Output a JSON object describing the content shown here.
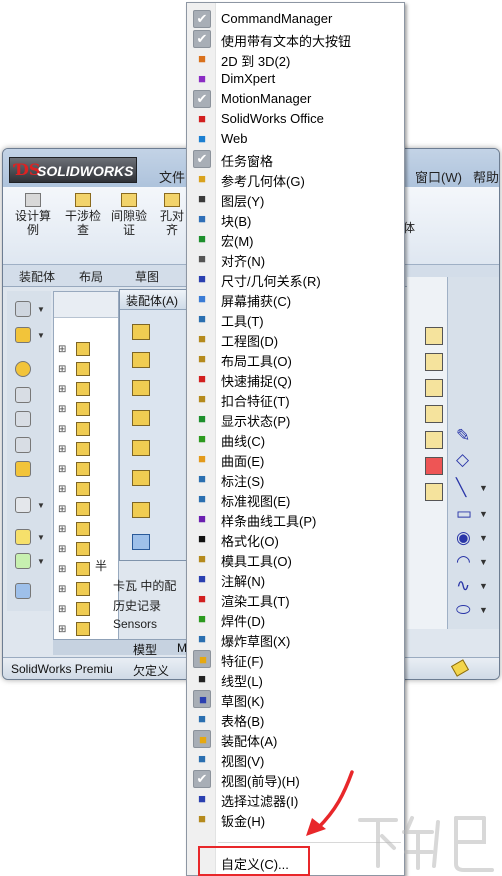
{
  "window": {
    "logo_mark": "ƊS",
    "logo_text": "SOLIDWORKS",
    "menu_file": "文件",
    "menu_window": "窗口(W)",
    "menu_help": "帮助",
    "ribbon_buttons": [
      "设计算例",
      "干涉检查",
      "间隙验证",
      "孔对齐"
    ],
    "ribbon_right_fragment": "体",
    "tabs": [
      "装配体",
      "布局",
      "草图"
    ],
    "assembly_panel_title": "装配体(A)",
    "tree_items": [
      "半",
      "卡瓦 中的配",
      "历史记录",
      "Sensors"
    ],
    "bottom_tabs": [
      "模型",
      "M"
    ],
    "status_left": "SolidWorks Premiu",
    "status_right": "欠定义"
  },
  "context_menu": {
    "items": [
      {
        "label": "CommandManager",
        "checked": true,
        "icon": "check-icon"
      },
      {
        "label": "使用带有文本的大按钮",
        "checked": true,
        "icon": "check-icon"
      },
      {
        "label": "2D 到 3D(2)",
        "checked": false,
        "icon": "2d-to-3d-icon",
        "color": "#d9711d"
      },
      {
        "label": "DimXpert",
        "checked": false,
        "icon": "dimxpert-icon",
        "color": "#8b2cc4"
      },
      {
        "label": "MotionManager",
        "checked": true,
        "icon": "check-icon"
      },
      {
        "label": "SolidWorks Office",
        "checked": false,
        "icon": "solidworks-office-icon",
        "color": "#d21f1f"
      },
      {
        "label": "Web",
        "checked": false,
        "icon": "web-globe-icon",
        "color": "#1b7fd1"
      },
      {
        "label": "任务窗格",
        "checked": true,
        "icon": "check-icon"
      },
      {
        "label": "参考几何体(G)",
        "checked": false,
        "icon": "reference-geometry-icon",
        "color": "#d9a21d"
      },
      {
        "label": "图层(Y)",
        "checked": false,
        "icon": "layer-icon",
        "color": "#3a3a3a"
      },
      {
        "label": "块(B)",
        "checked": false,
        "icon": "block-icon",
        "color": "#2f6fb7"
      },
      {
        "label": "宏(M)",
        "checked": false,
        "icon": "macro-icon",
        "color": "#1d8f2c"
      },
      {
        "label": "对齐(N)",
        "checked": false,
        "icon": "align-icon",
        "color": "#555555"
      },
      {
        "label": "尺寸/几何关系(R)",
        "checked": false,
        "icon": "dimension-icon",
        "color": "#2a3fb0"
      },
      {
        "label": "屏幕捕获(C)",
        "checked": false,
        "icon": "screen-capture-icon",
        "color": "#3a7bd5"
      },
      {
        "label": "工具(T)",
        "checked": false,
        "icon": "tools-icon",
        "color": "#2a6fb0"
      },
      {
        "label": "工程图(D)",
        "checked": false,
        "icon": "drawing-icon",
        "color": "#b58a1d"
      },
      {
        "label": "布局工具(O)",
        "checked": false,
        "icon": "layout-tools-icon",
        "color": "#b58a1d"
      },
      {
        "label": "快速捕捉(Q)",
        "checked": false,
        "icon": "quick-snap-icon",
        "color": "#d21f1f"
      },
      {
        "label": "扣合特征(T)",
        "checked": false,
        "icon": "fastening-feature-icon",
        "color": "#b58a1d"
      },
      {
        "label": "显示状态(P)",
        "checked": false,
        "icon": "display-state-icon",
        "color": "#1d8f2c"
      },
      {
        "label": "曲线(C)",
        "checked": false,
        "icon": "curve-icon",
        "color": "#2c9a1f"
      },
      {
        "label": "曲面(E)",
        "checked": false,
        "icon": "surface-icon",
        "color": "#e39a1b"
      },
      {
        "label": "标注(S)",
        "checked": false,
        "icon": "annotation-icon",
        "color": "#2a6fb0"
      },
      {
        "label": "标准视图(E)",
        "checked": false,
        "icon": "standard-views-icon",
        "color": "#2a6fb0"
      },
      {
        "label": "样条曲线工具(P)",
        "checked": false,
        "icon": "spline-tools-icon",
        "color": "#6b1fb0"
      },
      {
        "label": "格式化(O)",
        "checked": false,
        "icon": "format-icon",
        "color": "#111111"
      },
      {
        "label": "模具工具(O)",
        "checked": false,
        "icon": "mold-tools-icon",
        "color": "#b58a1d"
      },
      {
        "label": "注解(N)",
        "checked": false,
        "icon": "note-icon",
        "color": "#2a3fb0"
      },
      {
        "label": "渲染工具(T)",
        "checked": false,
        "icon": "render-tools-icon",
        "color": "#d21f1f"
      },
      {
        "label": "焊件(D)",
        "checked": false,
        "icon": "weldment-icon",
        "color": "#2c9a1f"
      },
      {
        "label": "爆炸草图(X)",
        "checked": false,
        "icon": "explode-sketch-icon",
        "color": "#2a6fb0"
      },
      {
        "label": "特征(F)",
        "checked": true,
        "icon": "features-icon",
        "color": "#e6a80f"
      },
      {
        "label": "线型(L)",
        "checked": false,
        "icon": "line-format-icon",
        "color": "#222222"
      },
      {
        "label": "草图(K)",
        "checked": true,
        "icon": "sketch-icon",
        "color": "#2a3fb0"
      },
      {
        "label": "表格(B)",
        "checked": false,
        "icon": "table-icon",
        "color": "#2a6fb0"
      },
      {
        "label": "装配体(A)",
        "checked": true,
        "icon": "assembly-icon",
        "color": "#e6a80f"
      },
      {
        "label": "视图(V)",
        "checked": false,
        "icon": "view-icon",
        "color": "#2a6fb0"
      },
      {
        "label": "视图(前导)(H)",
        "checked": true,
        "icon": "check-icon"
      },
      {
        "label": "选择过滤器(I)",
        "checked": false,
        "icon": "selection-filter-icon",
        "color": "#2a3fb0"
      },
      {
        "label": "钣金(H)",
        "checked": false,
        "icon": "sheet-metal-icon",
        "color": "#b58a1d"
      }
    ],
    "customize_label": "自定义(C)..."
  },
  "colors": {
    "highlight_box": "#e8272a",
    "arrow": "#e8272a",
    "check_background": "#a8aeb6"
  },
  "watermark_text": "下载吧"
}
